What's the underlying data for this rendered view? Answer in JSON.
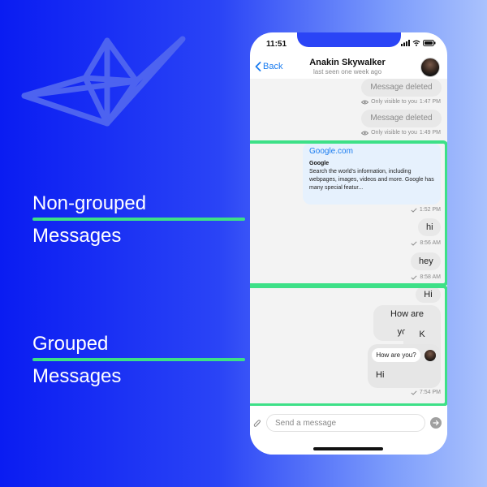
{
  "labels": {
    "non_grouped_line1": "Non-grouped",
    "non_grouped_line2": "Messages",
    "grouped_line1": "Grouped",
    "grouped_line2": "Messages"
  },
  "status_bar": {
    "time": "11:51",
    "icons": [
      "signal-icon",
      "wifi-icon",
      "battery-icon"
    ]
  },
  "header": {
    "back_label": "Back",
    "contact_name": "Anakin Skywalker",
    "last_seen": "last seen one week ago"
  },
  "messages": {
    "deleted_1": {
      "text": "Message deleted",
      "meta": "Only visible to you",
      "time": "1:47 PM"
    },
    "deleted_2": {
      "text": "Message deleted",
      "meta": "Only visible to you",
      "time": "1:49 PM"
    },
    "link_preview": {
      "url": "Google.com",
      "title": "Google",
      "description": "Search the world's information, including webpages, images, videos and more. Google has many special featur...",
      "time": "1:52 PM"
    },
    "hi_1": {
      "text": "hi",
      "time": "8:56 AM"
    },
    "hey": {
      "text": "hey",
      "time": "8:58 AM"
    },
    "grouped": [
      "Hi",
      "How are you?",
      "K cha"
    ],
    "reply": {
      "quoted": "How are you?",
      "text": "Hi",
      "time": "7:54 PM"
    }
  },
  "composer": {
    "placeholder": "Send a message"
  },
  "colors": {
    "accent": "#3de087",
    "link": "#1a7cf0"
  }
}
